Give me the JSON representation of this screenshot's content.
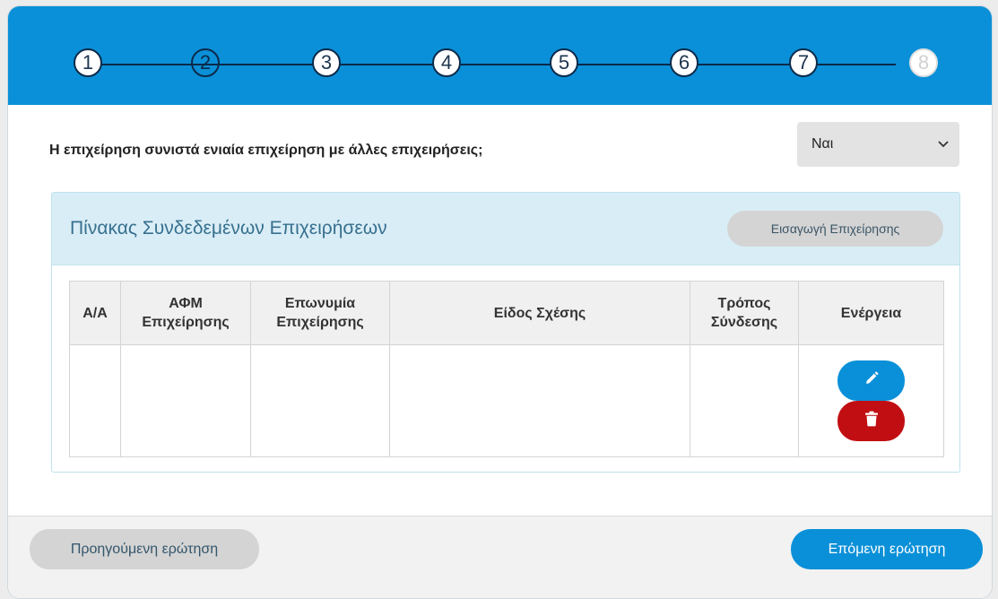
{
  "stepper": {
    "steps": [
      "1",
      "2",
      "3",
      "4",
      "5",
      "6",
      "7",
      "8"
    ],
    "current_step": "2",
    "disabled_step": "8"
  },
  "question": {
    "text": "Η επιχείρηση συνιστά ενιαία επιχείρηση με άλλες επιχειρήσεις;",
    "select_value": "Ναι"
  },
  "panel": {
    "title": "Πίνακας Συνδεδεμένων Επιχειρήσεων",
    "add_button": "Εισαγωγή Επιχείρησης"
  },
  "table": {
    "headers": [
      "Α/Α",
      "ΑΦΜ Επιχείρησης",
      "Επωνυμία Επιχείρησης",
      "Είδος Σχέσης",
      "Τρόπος Σύνδεσης",
      "Ενέργεια"
    ],
    "rows": [
      {
        "aa": "",
        "afm": "",
        "name": "",
        "relation": "",
        "connection": ""
      }
    ]
  },
  "icons": {
    "edit": "pencil-icon",
    "delete": "trash-icon"
  },
  "colors": {
    "accent": "#0a90d8",
    "danger": "#c10e12",
    "step_outline": "#0b2a4a"
  },
  "footer": {
    "prev_button": "Προηγούμενη ερώτηση",
    "next_button": "Επόμενη ερώτηση"
  }
}
